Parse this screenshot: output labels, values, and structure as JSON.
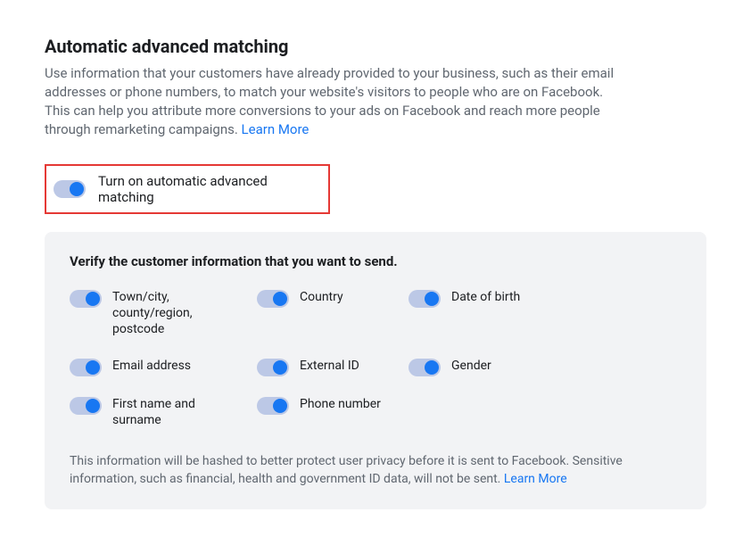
{
  "heading": "Automatic advanced matching",
  "description_text": "Use information that your customers have already provided to your business, such as their email addresses or phone numbers, to match your website's visitors to people who are on Facebook. This can help you attribute more conversions to your ads on Facebook and reach more people through remarketing campaigns. ",
  "description_link": "Learn More",
  "main_toggle": {
    "label": "Turn on automatic advanced matching"
  },
  "verify": {
    "heading": "Verify the customer information that you want to send.",
    "options": [
      {
        "label": "Town/city, county/region, postcode"
      },
      {
        "label": "Country"
      },
      {
        "label": "Date of birth"
      },
      {
        "label": "Email address"
      },
      {
        "label": "External ID"
      },
      {
        "label": "Gender"
      },
      {
        "label": "First name and surname"
      },
      {
        "label": "Phone number"
      }
    ],
    "footnote_text": "This information will be hashed to better protect user privacy before it is sent to Facebook. Sensitive information, such as financial, health and government ID data, will not be sent. ",
    "footnote_link": "Learn More"
  }
}
